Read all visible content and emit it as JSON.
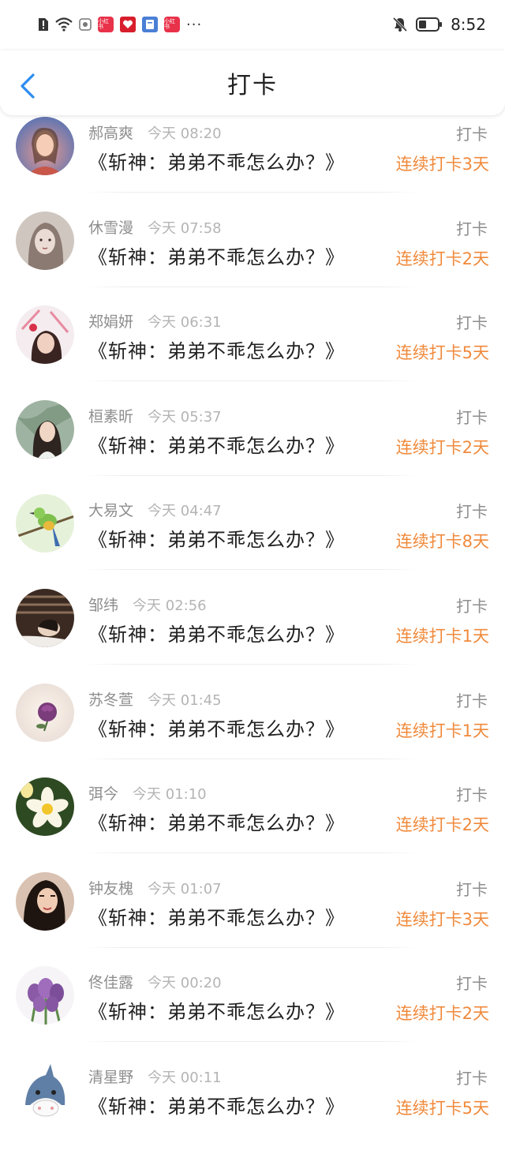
{
  "status_bar": {
    "time": "8:52",
    "badges": [
      "小红书",
      "小红书"
    ],
    "more": "···"
  },
  "nav": {
    "title": "打卡"
  },
  "items": [
    {
      "name": "郝高爽",
      "time": "今天 08:20",
      "book": "《斩神：弟弟不乖怎么办？》",
      "action": "打卡",
      "streak": "连续打卡3天",
      "avatar_icon": "portrait-avatar"
    },
    {
      "name": "休雪漫",
      "time": "今天 07:58",
      "book": "《斩神：弟弟不乖怎么办？》",
      "action": "打卡",
      "streak": "连续打卡2天",
      "avatar_icon": "portrait-avatar"
    },
    {
      "name": "郑娟妍",
      "time": "今天 06:31",
      "book": "《斩神：弟弟不乖怎么办？》",
      "action": "打卡",
      "streak": "连续打卡5天",
      "avatar_icon": "portrait-avatar"
    },
    {
      "name": "桓素昕",
      "time": "今天 05:37",
      "book": "《斩神：弟弟不乖怎么办？》",
      "action": "打卡",
      "streak": "连续打卡2天",
      "avatar_icon": "portrait-avatar"
    },
    {
      "name": "大易文",
      "time": "今天 04:47",
      "book": "《斩神：弟弟不乖怎么办？》",
      "action": "打卡",
      "streak": "连续打卡8天",
      "avatar_icon": "bird-avatar"
    },
    {
      "name": "邹纬",
      "time": "今天 02:56",
      "book": "《斩神：弟弟不乖怎么办？》",
      "action": "打卡",
      "streak": "连续打卡1天",
      "avatar_icon": "portrait-avatar"
    },
    {
      "name": "苏冬萱",
      "time": "今天 01:45",
      "book": "《斩神：弟弟不乖怎么办？》",
      "action": "打卡",
      "streak": "连续打卡1天",
      "avatar_icon": "rose-avatar"
    },
    {
      "name": "弭今",
      "time": "今天 01:10",
      "book": "《斩神：弟弟不乖怎么办？》",
      "action": "打卡",
      "streak": "连续打卡2天",
      "avatar_icon": "flower-avatar"
    },
    {
      "name": "钟友槐",
      "time": "今天 01:07",
      "book": "《斩神：弟弟不乖怎么办？》",
      "action": "打卡",
      "streak": "连续打卡3天",
      "avatar_icon": "portrait-avatar"
    },
    {
      "name": "佟佳露",
      "time": "今天 00:20",
      "book": "《斩神：弟弟不乖怎么办？》",
      "action": "打卡",
      "streak": "连续打卡2天",
      "avatar_icon": "tulip-avatar"
    },
    {
      "name": "清星野",
      "time": "今天 00:11",
      "book": "《斩神：弟弟不乖怎么办？》",
      "action": "打卡",
      "streak": "连续打卡5天",
      "avatar_icon": "shark-avatar"
    }
  ],
  "colors": {
    "accent": "#2d8cf0",
    "streak": "#f08a3c",
    "muted": "#8e8e8e"
  }
}
